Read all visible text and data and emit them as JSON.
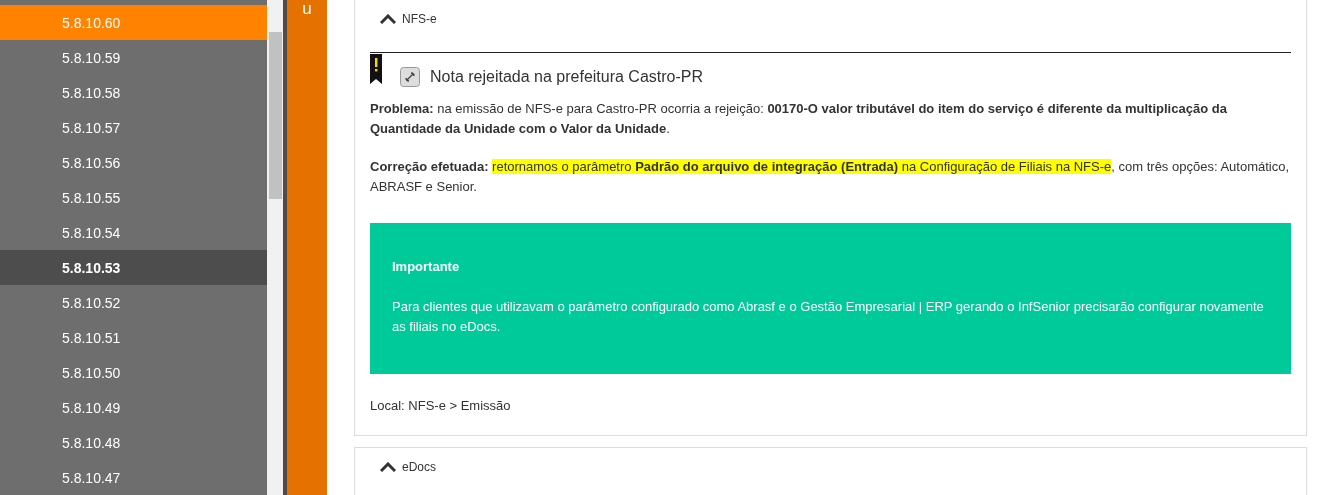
{
  "sidebar": {
    "items": [
      {
        "label": "5.8.10.60",
        "active": true,
        "selected": false
      },
      {
        "label": "5.8.10.59",
        "active": false,
        "selected": false
      },
      {
        "label": "5.8.10.58",
        "active": false,
        "selected": false
      },
      {
        "label": "5.8.10.57",
        "active": false,
        "selected": false
      },
      {
        "label": "5.8.10.56",
        "active": false,
        "selected": false
      },
      {
        "label": "5.8.10.55",
        "active": false,
        "selected": false
      },
      {
        "label": "5.8.10.54",
        "active": false,
        "selected": false
      },
      {
        "label": "5.8.10.53",
        "active": false,
        "selected": true
      },
      {
        "label": "5.8.10.52",
        "active": false,
        "selected": false
      },
      {
        "label": "5.8.10.51",
        "active": false,
        "selected": false
      },
      {
        "label": "5.8.10.50",
        "active": false,
        "selected": false
      },
      {
        "label": "5.8.10.49",
        "active": false,
        "selected": false
      },
      {
        "label": "5.8.10.48",
        "active": false,
        "selected": false
      },
      {
        "label": "5.8.10.47",
        "active": false,
        "selected": false
      }
    ]
  },
  "side_tab": {
    "label": "u"
  },
  "sections": [
    {
      "title": "NFS-e",
      "expanded": true,
      "note": {
        "title": "Nota rejeitada na prefeitura Castro-PR",
        "problem": "**Problema:** na emissão de NFS-e para Castro-PR ocorria a rejeição: **00170-O valor tributável do item do serviço é diferente da multiplicação da Quantidade da Unidade com o Valor da Unidade**.",
        "correction": [
          {
            "text": "Correção efetuada: ",
            "bold": true,
            "highlighted": false
          },
          {
            "text": "retornamos o parâmetro ",
            "bold": false,
            "highlighted": true
          },
          {
            "text": "Padrão do arquivo de integração (Entrada)",
            "bold": true,
            "highlighted": true
          },
          {
            "text": " na Configuração de Filiais na NFS-e",
            "bold": false,
            "highlighted": true
          },
          {
            "text": ", com três opções: Automático, ABRASF e Senior.",
            "bold": false,
            "highlighted": false
          }
        ],
        "callout": {
          "title": "Importante",
          "text": "Para clientes que utilizavam o parâmetro configurado como Abrasf e o Gestão Empresarial | ERP gerando o InfSenior precisarão configurar novamente as filiais no eDocs."
        },
        "location": "Local: NFS-e > Emissão"
      }
    },
    {
      "title": "eDocs",
      "expanded": true
    }
  ]
}
